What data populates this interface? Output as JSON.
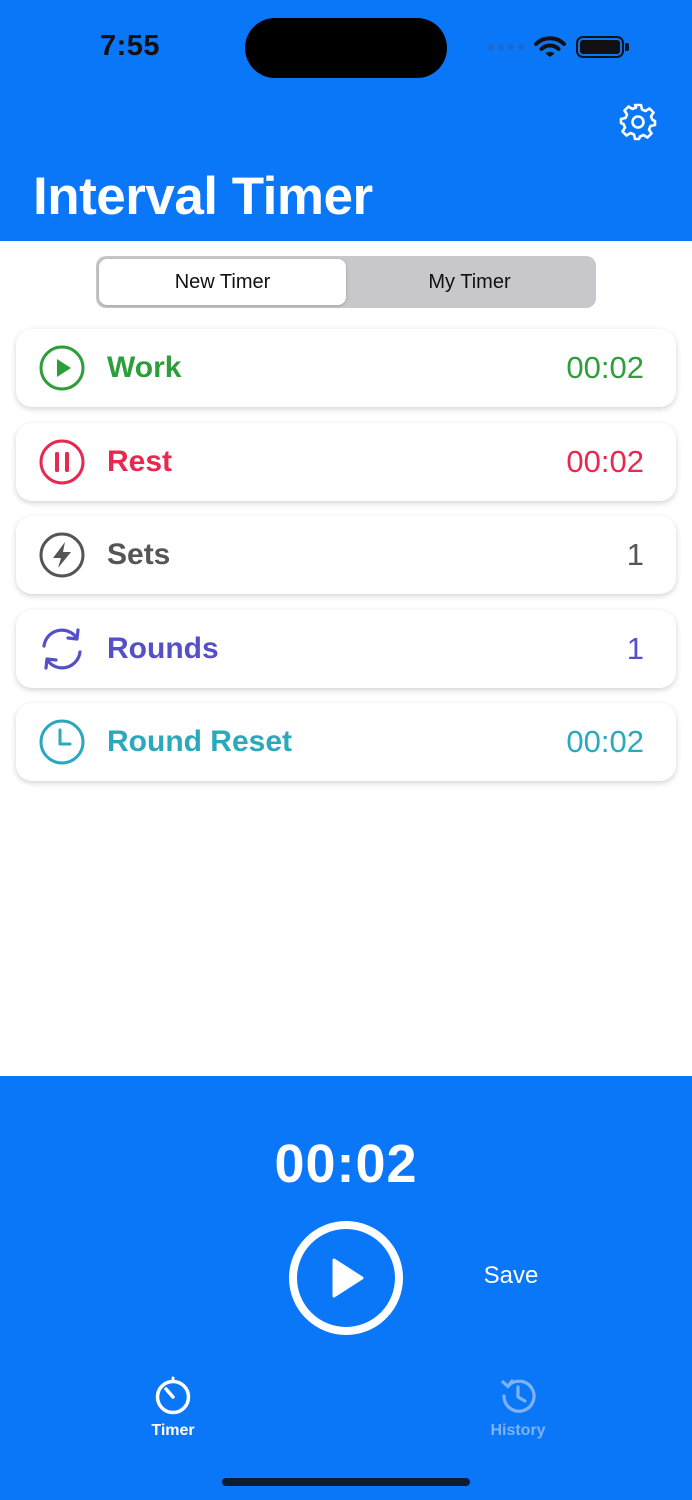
{
  "status_bar": {
    "time": "7:55"
  },
  "header": {
    "title": "Interval Timer",
    "settings_icon": "gear-icon"
  },
  "segmented": {
    "options": [
      "New Timer",
      "My Timer"
    ],
    "selected": "New Timer"
  },
  "rows": [
    {
      "label": "Work",
      "value": "00:02",
      "icon": "play-circle-icon",
      "color": "#2E9E3B"
    },
    {
      "label": "Rest",
      "value": "00:02",
      "icon": "pause-circle-icon",
      "color": "#E8294F"
    },
    {
      "label": "Sets",
      "value": "1",
      "icon": "bolt-circle-icon",
      "color": "#555555"
    },
    {
      "label": "Rounds",
      "value": "1",
      "icon": "repeat-icon",
      "color": "#5550C8"
    },
    {
      "label": "Round Reset",
      "value": "00:02",
      "icon": "clock-icon",
      "color": "#2BA9BC"
    }
  ],
  "player": {
    "time": "00:02",
    "play_icon": "play-icon",
    "save_label": "Save"
  },
  "tabs": [
    {
      "label": "Timer",
      "icon": "timer-icon",
      "active": true
    },
    {
      "label": "History",
      "icon": "history-icon",
      "active": false
    }
  ],
  "colors": {
    "accent": "#0A76F8",
    "tab_inactive": "#7FB2EE"
  }
}
